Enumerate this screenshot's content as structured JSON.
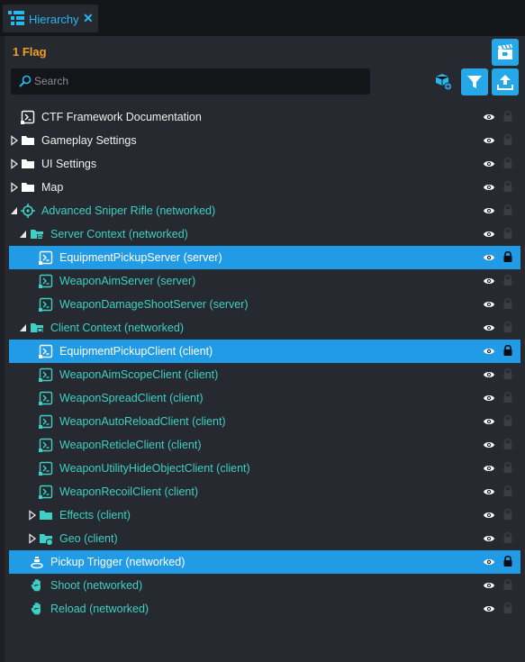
{
  "tab": {
    "title": "Hierarchy",
    "close": "✕"
  },
  "header": {
    "flag_count": "1 Flag"
  },
  "search": {
    "placeholder": "Search",
    "value": ""
  },
  "colors": {
    "accent": "#229be6",
    "flag": "#f0a020",
    "script_text": "#3ed0c4",
    "background": "#262930"
  },
  "tree": [
    {
      "label": "CTF Framework Documentation",
      "icon": "script-icon",
      "depth": 0,
      "expander": "none",
      "color": "white",
      "selected": false,
      "locked": false
    },
    {
      "label": "Gameplay Settings",
      "icon": "folder-icon",
      "depth": 0,
      "expander": "collapsed",
      "color": "white",
      "selected": false,
      "locked": false
    },
    {
      "label": "UI Settings",
      "icon": "folder-icon",
      "depth": 0,
      "expander": "collapsed",
      "color": "white",
      "selected": false,
      "locked": false
    },
    {
      "label": "Map",
      "icon": "folder-icon",
      "depth": 0,
      "expander": "collapsed",
      "color": "white",
      "selected": false,
      "locked": false
    },
    {
      "label": "Advanced Sniper Rifle (networked)",
      "icon": "crosshair-icon",
      "depth": 0,
      "expander": "expanded",
      "color": "cyan",
      "selected": false,
      "locked": false
    },
    {
      "label": "Server Context (networked)",
      "icon": "server-context-icon",
      "depth": 1,
      "expander": "expanded",
      "color": "cyan",
      "selected": false,
      "locked": false
    },
    {
      "label": "EquipmentPickupServer (server)",
      "icon": "script-icon",
      "depth": 2,
      "expander": "none",
      "color": "cyan",
      "selected": true,
      "locked": true
    },
    {
      "label": "WeaponAimServer (server)",
      "icon": "script-icon",
      "depth": 2,
      "expander": "none",
      "color": "cyan",
      "selected": false,
      "locked": false
    },
    {
      "label": "WeaponDamageShootServer (server)",
      "icon": "script-icon",
      "depth": 2,
      "expander": "none",
      "color": "cyan",
      "selected": false,
      "locked": false
    },
    {
      "label": "Client Context (networked)",
      "icon": "client-context-icon",
      "depth": 1,
      "expander": "expanded",
      "color": "cyan",
      "selected": false,
      "locked": false
    },
    {
      "label": "EquipmentPickupClient (client)",
      "icon": "script-icon",
      "depth": 2,
      "expander": "none",
      "color": "cyan",
      "selected": true,
      "locked": true
    },
    {
      "label": "WeaponAimScopeClient (client)",
      "icon": "script-icon",
      "depth": 2,
      "expander": "none",
      "color": "cyan",
      "selected": false,
      "locked": false
    },
    {
      "label": "WeaponSpreadClient (client)",
      "icon": "script-icon",
      "depth": 2,
      "expander": "none",
      "color": "cyan",
      "selected": false,
      "locked": false
    },
    {
      "label": "WeaponAutoReloadClient (client)",
      "icon": "script-icon",
      "depth": 2,
      "expander": "none",
      "color": "cyan",
      "selected": false,
      "locked": false
    },
    {
      "label": "WeaponReticleClient (client)",
      "icon": "script-icon",
      "depth": 2,
      "expander": "none",
      "color": "cyan",
      "selected": false,
      "locked": false
    },
    {
      "label": "WeaponUtilityHideObjectClient (client)",
      "icon": "script-icon",
      "depth": 2,
      "expander": "none",
      "color": "cyan",
      "selected": false,
      "locked": false
    },
    {
      "label": "WeaponRecoilClient (client)",
      "icon": "script-icon",
      "depth": 2,
      "expander": "none",
      "color": "cyan",
      "selected": false,
      "locked": false
    },
    {
      "label": "Effects (client)",
      "icon": "folder-icon",
      "depth": 2,
      "expander": "collapsed",
      "color": "cyan",
      "selected": false,
      "locked": false
    },
    {
      "label": "Geo (client)",
      "icon": "geo-folder-icon",
      "depth": 2,
      "expander": "collapsed",
      "color": "cyan",
      "selected": false,
      "locked": false
    },
    {
      "label": "Pickup Trigger (networked)",
      "icon": "trigger-icon",
      "depth": 1,
      "expander": "none",
      "color": "white",
      "selected": true,
      "locked": true
    },
    {
      "label": "Shoot (networked)",
      "icon": "ability-icon",
      "depth": 1,
      "expander": "none",
      "color": "cyan",
      "selected": false,
      "locked": false
    },
    {
      "label": "Reload (networked)",
      "icon": "ability-icon",
      "depth": 1,
      "expander": "none",
      "color": "cyan",
      "selected": false,
      "locked": false
    }
  ]
}
